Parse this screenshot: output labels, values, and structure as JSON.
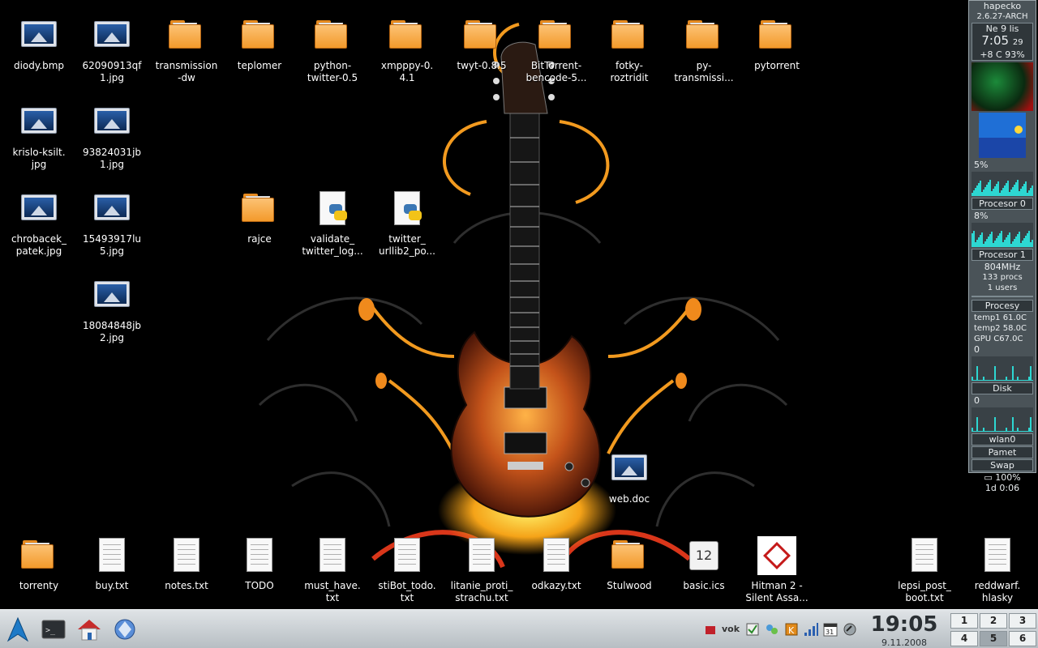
{
  "desktop": {
    "icons": [
      {
        "label": "diody.bmp",
        "kind": "image"
      },
      {
        "label": "62090913qf\n1.jpg",
        "kind": "image"
      },
      {
        "label": "transmission\n-dw",
        "kind": "folder"
      },
      {
        "label": "teplomer",
        "kind": "folder"
      },
      {
        "label": "python-\ntwitter-0.5",
        "kind": "folder"
      },
      {
        "label": "xmpppy-0.\n4.1",
        "kind": "folder"
      },
      {
        "label": "twyt-0.8.5",
        "kind": "folder"
      },
      {
        "label": "BitTorrent-\nbencode-5...",
        "kind": "folder"
      },
      {
        "label": "fotky-\nroztridit",
        "kind": "folder"
      },
      {
        "label": "py-\ntransmissi...",
        "kind": "folder"
      },
      {
        "label": "pytorrent",
        "kind": "folder"
      },
      {
        "label": "krislo-ksilt.\njpg",
        "kind": "image"
      },
      {
        "label": "93824031jb\n1.jpg",
        "kind": "image"
      },
      {
        "label": "chrobacek_\npatek.jpg",
        "kind": "image"
      },
      {
        "label": "15493917lu\n5.jpg",
        "kind": "image"
      },
      {
        "label": "rajce",
        "kind": "folder"
      },
      {
        "label": "validate_\ntwitter_log...",
        "kind": "python"
      },
      {
        "label": "twitter_\nurllib2_po...",
        "kind": "python"
      },
      {
        "label": "18084848jb\n2.jpg",
        "kind": "image"
      },
      {
        "label": "web.doc",
        "kind": "image"
      },
      {
        "label": "torrenty",
        "kind": "folder"
      },
      {
        "label": "buy.txt",
        "kind": "text"
      },
      {
        "label": "notes.txt",
        "kind": "text"
      },
      {
        "label": "TODO",
        "kind": "text"
      },
      {
        "label": "must_have.\ntxt",
        "kind": "text"
      },
      {
        "label": "stiBot_todo.\ntxt",
        "kind": "text"
      },
      {
        "label": "litanie_proti_\nstrachu.txt",
        "kind": "text"
      },
      {
        "label": "odkazy.txt",
        "kind": "text"
      },
      {
        "label": "Stulwood",
        "kind": "folder"
      },
      {
        "label": "basic.ics",
        "kind": "calendar"
      },
      {
        "label": "Hitman 2 -\nSilent Assa...",
        "kind": "hitman"
      },
      {
        "label": "lepsi_post_\nboot.txt",
        "kind": "text"
      },
      {
        "label": "reddwarf.\nhlasky",
        "kind": "text"
      }
    ],
    "calendar_day": "12"
  },
  "conky": {
    "hostname": "hapecko",
    "kernel": "2.6.27-ARCH",
    "date": "Ne  9 lis",
    "time": "7:05",
    "seconds": "29",
    "weather": "+8 C 93%",
    "cpu0_pct": "5%",
    "cpu0_label": "Procesor 0",
    "cpu1_pct": "8%",
    "cpu1_label": "Procesor 1",
    "freq": "804MHz",
    "procs": "133 procs",
    "users": "1 users",
    "procesy_label": "Procesy",
    "temp1_label": "temp1",
    "temp1": "61.0C",
    "temp2_label": "temp2",
    "temp2": "58.0C",
    "gpu_label": "GPU",
    "gpu": "C67.0C",
    "disk_zero": "0",
    "disk_label": "Disk",
    "disk_zero2": "0",
    "wlan_label": "wlan0",
    "mem_label": "Pamet",
    "swap_label": "Swap",
    "battery": "100%",
    "uptime": "1d 0:06"
  },
  "taskbar": {
    "clock_time": "19:05",
    "clock_date": "9.11.2008",
    "tray_text": "vok",
    "tray_cal": "31",
    "pager": [
      "1",
      "2",
      "3",
      "4",
      "5",
      "6"
    ],
    "active_desktop": "5"
  }
}
